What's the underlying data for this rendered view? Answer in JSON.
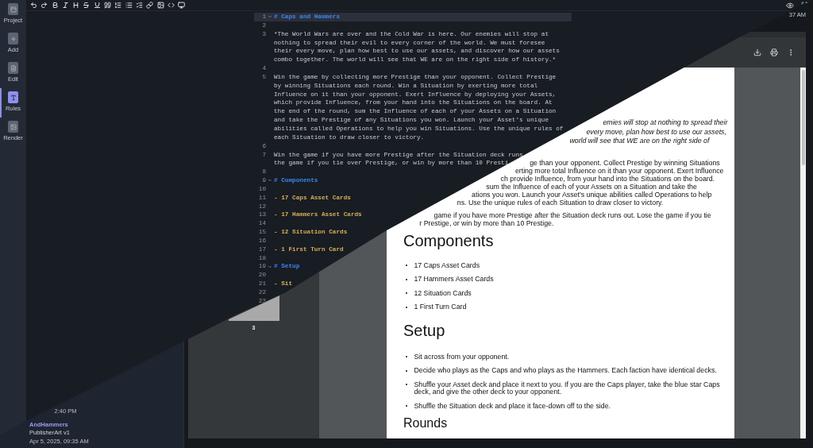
{
  "sidebar": {
    "items": [
      {
        "kind": "project",
        "label": "Project",
        "selected": false
      },
      {
        "kind": "add",
        "label": "Add",
        "selected": false
      },
      {
        "kind": "edit",
        "label": "Edit",
        "selected": false
      },
      {
        "kind": "rules",
        "label": "Rules",
        "selected": true
      },
      {
        "kind": "render",
        "label": "Render",
        "selected": false
      }
    ]
  },
  "editor": {
    "lines": [
      {
        "number": "1",
        "kind": "heading",
        "foldable": true,
        "current": true,
        "rows": [
          "# Caps and Hammers"
        ]
      },
      {
        "number": "2",
        "kind": "blank",
        "foldable": false,
        "current": false
      },
      {
        "number": "3",
        "kind": "plain",
        "foldable": false,
        "current": false,
        "rows": [
          "*The World Wars are over and the Cold War is here. Our enemies will stop at",
          "nothing to spread their evil to every corner of the world. We must foresee",
          "their every move, plan how best to use our assets, and discover how our assets",
          "combo together. The world will see that WE are on the right side of history.*"
        ]
      },
      {
        "number": "4",
        "kind": "blank",
        "foldable": false,
        "current": false
      },
      {
        "number": "5",
        "kind": "plain",
        "foldable": false,
        "current": false,
        "rows": [
          "Win the game by collecting more Prestige than your opponent. Collect Prestige",
          "by winning Situations each round. Win a Situation by exerting more total",
          "Influence on it than your opponent. Exert Influence by deploying your Assets,",
          "which provide Influence, from your hand into the Situations on the board. At",
          "the end of the round, sum the Influence of each of your Assets on a Situation",
          "and take the Prestige of any Situations you won. Launch your Asset's unique",
          "abilities called Operations to help you win Situations. Use the unique rules of",
          "each Situation to draw closer to victory."
        ]
      },
      {
        "number": "6",
        "kind": "blank",
        "foldable": false,
        "current": false
      },
      {
        "number": "7",
        "kind": "plain",
        "foldable": false,
        "current": false,
        "rows": [
          "Win the game if you have more Prestige after the Situation deck runs",
          "the game if you tie over Prestige, or win by more than 10 Presti"
        ]
      },
      {
        "number": "8",
        "kind": "blank",
        "foldable": false,
        "current": false
      },
      {
        "number": "9",
        "kind": "heading",
        "foldable": true,
        "current": false,
        "rows": [
          "# Components"
        ]
      },
      {
        "number": "10",
        "kind": "blank",
        "foldable": false,
        "current": false
      },
      {
        "number": "11",
        "kind": "list",
        "foldable": false,
        "current": false,
        "rows": [
          "- 17 Caps Asset Cards"
        ]
      },
      {
        "number": "12",
        "kind": "blank",
        "foldable": false,
        "current": false
      },
      {
        "number": "13",
        "kind": "list",
        "foldable": false,
        "current": false,
        "rows": [
          "- 17 Hammers Asset Cards"
        ]
      },
      {
        "number": "14",
        "kind": "blank",
        "foldable": false,
        "current": false
      },
      {
        "number": "15",
        "kind": "list",
        "foldable": false,
        "current": false,
        "rows": [
          "- 12 Situation Cards"
        ]
      },
      {
        "number": "16",
        "kind": "blank",
        "foldable": false,
        "current": false
      },
      {
        "number": "17",
        "kind": "list",
        "foldable": false,
        "current": false,
        "rows": [
          "- 1 First Turn Card"
        ]
      },
      {
        "number": "18",
        "kind": "blank",
        "foldable": false,
        "current": false
      },
      {
        "number": "19",
        "kind": "heading",
        "foldable": true,
        "current": false,
        "rows": [
          "# Setup"
        ]
      },
      {
        "number": "20",
        "kind": "blank",
        "foldable": false,
        "current": false
      },
      {
        "number": "21",
        "kind": "list",
        "foldable": false,
        "current": false,
        "rows": [
          "- Sit"
        ]
      },
      {
        "number": "22",
        "kind": "blank",
        "foldable": false,
        "current": false
      },
      {
        "number": "23",
        "kind": "blank",
        "foldable": false,
        "current": false
      }
    ]
  },
  "clock": "37 AM",
  "versions": {
    "items": [
      {
        "kind": "time",
        "text": "2:40 PM"
      },
      {
        "kind": "name",
        "text": "AndHammers"
      },
      {
        "kind": "detail",
        "text": "PublisherArt v1"
      },
      {
        "kind": "time",
        "text": "Apr 5, 2025, 09:35 AM"
      }
    ]
  },
  "pdf_viewer": {
    "thumbnails": [
      {
        "label": "3"
      }
    ],
    "page": {
      "blocks": [
        {
          "kind": "italic",
          "lines": [
            "emies will stop at nothing to spread their",
            "every move, plan how best to use our assets,",
            "world will see that WE are on the right side of"
          ]
        },
        {
          "kind": "fragment",
          "lines": [
            "ge than your opponent. Collect Prestige by winning Situations",
            "erting more total Influence on it than your opponent. Exert Influence",
            "ch provide Influence, from your hand into the Situations on the board.",
            "sum the Influence of each of your Assets on a Situation and take the",
            "ations you won. Launch your Asset's unique abilities called Operations to help",
            "ns. Use the unique rules of each Situation to draw closer to victory."
          ]
        },
        {
          "kind": "fragment",
          "lines": [
            "game if you have more Prestige after the Situation deck runs out. Lose the game if you tie",
            "r Prestige, or win by more than 10 Prestige."
          ]
        },
        {
          "kind": "heading",
          "text": "Components"
        },
        {
          "kind": "list",
          "items": [
            "17 Caps Asset Cards",
            "17 Hammers Asset Cards",
            "12 Situation Cards",
            "1 First Turn Card"
          ]
        },
        {
          "kind": "heading",
          "text": "Setup"
        },
        {
          "kind": "list",
          "items": [
            "Sit across from your opponent.",
            "Decide who plays as the Caps and who plays as the Hammers. Each faction have identical decks.",
            "Shuffle your Asset deck and place it next to you. If you are the Caps player, take the blue star Caps deck, and give the other deck to your opponent.",
            "Shuffle the Situation deck and place it face-down off to the side."
          ]
        },
        {
          "kind": "subheading",
          "text": "Rounds"
        }
      ]
    }
  }
}
